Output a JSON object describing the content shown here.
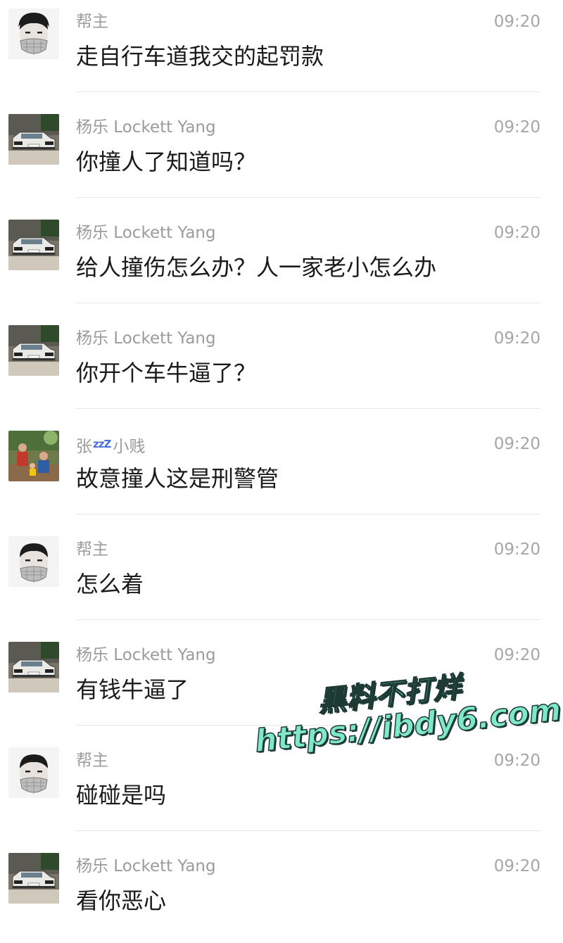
{
  "messages": [
    {
      "sender": "帮主",
      "time": "09:20",
      "text": "走自行车道我交的起罚款",
      "avatar": "masked-man"
    },
    {
      "sender": "杨乐 Lockett Yang",
      "time": "09:20",
      "text": "你撞人了知道吗？",
      "avatar": "car"
    },
    {
      "sender": "杨乐 Lockett Yang",
      "time": "09:20",
      "text": "给人撞伤怎么办？人一家老小怎么办",
      "avatar": "car"
    },
    {
      "sender": "杨乐 Lockett Yang",
      "time": "09:20",
      "text": "你开个车牛逼了？",
      "avatar": "car"
    },
    {
      "sender": "张",
      "sender_zzz": "zzZ",
      "sender_suffix": "小贱",
      "time": "09:20",
      "text": "故意撞人这是刑警管",
      "avatar": "family-photo"
    },
    {
      "sender": "帮主",
      "time": "09:20",
      "text": "怎么着",
      "avatar": "masked-man"
    },
    {
      "sender": "杨乐 Lockett Yang",
      "time": "09:20",
      "text": "有钱牛逼了",
      "avatar": "car"
    },
    {
      "sender": "帮主",
      "time": "09:20",
      "text": "碰碰是吗",
      "avatar": "masked-man"
    },
    {
      "sender": "杨乐 Lockett Yang",
      "time": "09:20",
      "text": "看你恶心",
      "avatar": "car"
    }
  ],
  "watermark": {
    "line1": "黑料不打烊",
    "line2": "https://ibdy6.com",
    "fill_color": "#7ee8c8",
    "outline_color": "#1e3a34"
  }
}
